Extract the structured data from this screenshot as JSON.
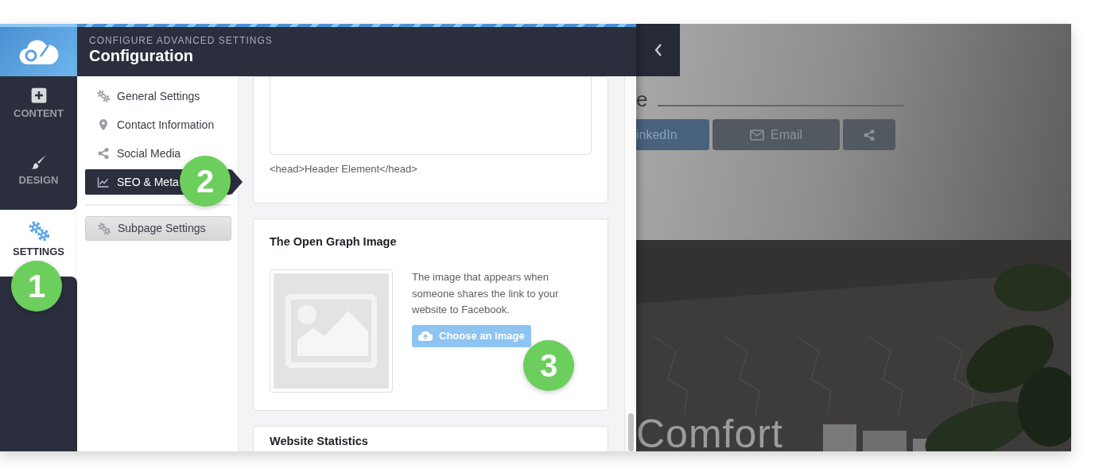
{
  "rail": [
    {
      "label": "CONTENT",
      "selected": false
    },
    {
      "label": "DESIGN",
      "selected": false
    },
    {
      "label": "SETTINGS",
      "selected": true
    }
  ],
  "header": {
    "eyebrow": "CONFIGURE ADVANCED SETTINGS",
    "title": "Configuration"
  },
  "submenu": [
    {
      "label": "General Settings",
      "selected": false
    },
    {
      "label": "Contact Information",
      "selected": false
    },
    {
      "label": "Social Media",
      "selected": false
    },
    {
      "label": "SEO & Meta",
      "selected": true
    }
  ],
  "subpage_button": {
    "label": "Subpage Settings"
  },
  "head_card": {
    "hint": "<head>Header Element</head>"
  },
  "og_card": {
    "title": "The Open Graph Image",
    "description": "The image that appears when someone shares the link to your website to Facebook.",
    "button": "Choose an image"
  },
  "stats_card": {
    "title": "Website Statistics"
  },
  "preview": {
    "heading_fragment": "e",
    "buttons": [
      {
        "kind": "linkedin",
        "label": "inkedIn"
      },
      {
        "kind": "email",
        "label": "Email"
      },
      {
        "kind": "share"
      }
    ],
    "hero_title": "Comfort"
  },
  "steps": [
    "1",
    "2",
    "3"
  ]
}
